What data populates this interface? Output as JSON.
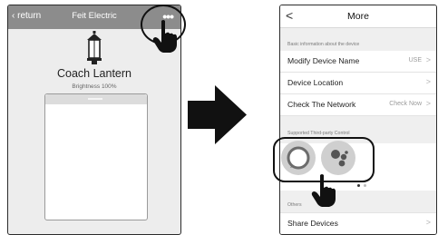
{
  "left": {
    "back_label": "return",
    "title": "Feit Electric",
    "more_label": "•••",
    "device_name": "Coach Lantern",
    "brightness": "Brightness 100%"
  },
  "right": {
    "back_label": "<",
    "title": "More",
    "section_basic": "Basic information about the device",
    "rows": [
      {
        "label": "Modify Device Name",
        "value": "USE",
        "chevron": ">"
      },
      {
        "label": "Device Location",
        "value": "",
        "chevron": ">"
      },
      {
        "label": "Check The Network",
        "value": "Check Now",
        "chevron": ">"
      }
    ],
    "section_third_party": "Supported Third-party Control",
    "section_others": "Others",
    "share_row": {
      "label": "Share Devices",
      "chevron": ">"
    }
  },
  "icons": [
    "lantern-icon",
    "pointing-hand-icon",
    "arrow-right-icon",
    "alexa-icon",
    "google-assistant-icon"
  ],
  "colors": {
    "header_gray": "#8c8c8c",
    "google_blue": "#4285f4",
    "google_red": "#ea4335",
    "google_yellow": "#fbbc05",
    "google_green": "#34a853"
  }
}
